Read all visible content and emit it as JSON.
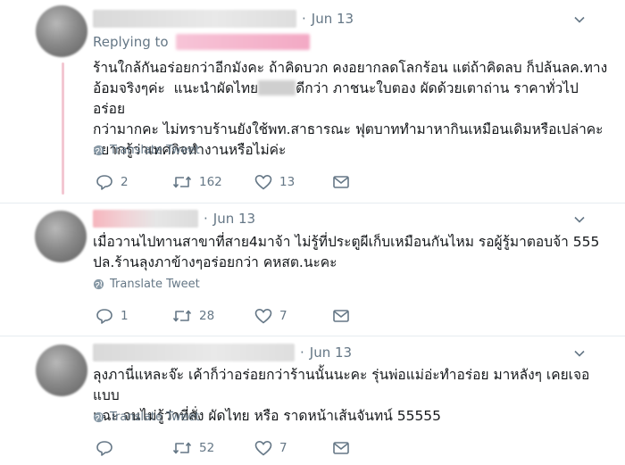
{
  "tweets": [
    {
      "date": "Jun 13",
      "replying_label": "Replying to",
      "body_part1": "ร้านใกล้กันอร่อยกว่าอีกมังคะ ถ้าคิดบวก คงอยากลดโลกร้อน แต่ถ้าคิดลบ ก็ปล้นลค.ทาง\nอ้อมจริงๆค่ะ  แนะนำผัดไทย",
      "body_part2": "ดีกว่า ภาชนะใบตอง ผัดด้วยเตาถ่าน ราคาทั่วไป อร่อย\nกว่ามากคะ ไม่ทราบร้านยังใช้พท.สาธารณะ ฟุตบาททำมาหากินเหมือนเดิมหรือเปล่าคะ\nอยากรู้ว่าเทศกิจทำงานหรือไม่ค่ะ",
      "translate": "Translate Tweet",
      "replies": "2",
      "retweets": "162",
      "likes": "13"
    },
    {
      "date": "Jun 13",
      "body": "เมื่อวานไปทานสาขาที่สาย4มาจ้า ไม่รู้ที่ประตูผีเก็บเหมือนกันไหม รอผู้รู้มาตอบจ้า 555\nปล.ร้านลุงภาข้างๆอร่อยกว่า คหสต.นะคะ",
      "translate": "Translate Tweet",
      "replies": "1",
      "retweets": "28",
      "likes": "7"
    },
    {
      "date": "Jun 13",
      "body": "ลุงภานี่แหละจ๊ะ เค้าก็ว่าอร่อยกว่าร้านนั้นนะคะ รุ่นพ่อแม่อ่ะทำอร่อย มาหลังๆ เคยเจอแบบ\nแฉะ จนไม่รู้ว่าที่สั่ง ผัดไทย หรือ ราดหน้าเส้นจันทน์ 55555",
      "translate": "Translate Tweet",
      "replies": "",
      "retweets": "52",
      "likes": "7"
    }
  ],
  "icons": {
    "reply": "speech-bubble-icon",
    "retweet": "retweet-arrows-icon",
    "like": "heart-outline-icon",
    "dm": "envelope-icon",
    "translate": "globe-icon",
    "more": "chevron-down-icon"
  },
  "colors": {
    "text": "#14171a",
    "muted": "#657786",
    "thread_line": "#f3c7d2",
    "divider": "#e6ecf0"
  }
}
